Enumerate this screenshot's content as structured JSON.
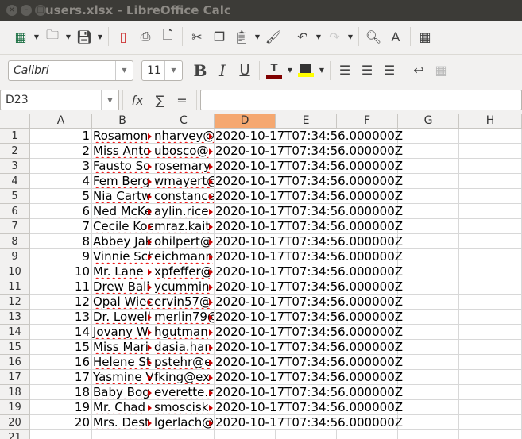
{
  "window": {
    "title": "users.xlsx - LibreOffice Calc"
  },
  "toolbar": {
    "font_name": "Calibri",
    "font_size": "11",
    "colors": {
      "font_color": "#800000",
      "highlight": "#ffff00"
    }
  },
  "formula_bar": {
    "name_box": "D23",
    "formula": ""
  },
  "columns": [
    "A",
    "B",
    "C",
    "D",
    "E",
    "F",
    "G",
    "H"
  ],
  "selected_column": "D",
  "rows": [
    {
      "id": "1",
      "name": "Rosamon",
      "email": "nharvey@",
      "date": "2020-10-17T07:34:56.000000Z"
    },
    {
      "id": "2",
      "name": "Miss Anto",
      "email": "ubosco@",
      "date": "2020-10-17T07:34:56.000000Z"
    },
    {
      "id": "3",
      "name": "Fausto So",
      "email": "rosemary",
      "date": "2020-10-17T07:34:56.000000Z"
    },
    {
      "id": "4",
      "name": "Fem Berg",
      "email": "wmayert@",
      "date": "2020-10-17T07:34:56.000000Z"
    },
    {
      "id": "5",
      "name": "Nia Cartw",
      "email": "constance",
      "date": "2020-10-17T07:34:56.000000Z"
    },
    {
      "id": "6",
      "name": "Ned McKe",
      "email": "aylin.rice",
      "date": "2020-10-17T07:34:56.000000Z"
    },
    {
      "id": "7",
      "name": "Cecile Koe",
      "email": "mraz.kait",
      "date": "2020-10-17T07:34:56.000000Z"
    },
    {
      "id": "8",
      "name": "Abbey Jak",
      "email": "ohilpert@",
      "date": "2020-10-17T07:34:56.000000Z"
    },
    {
      "id": "9",
      "name": "Vinnie Sch",
      "email": "eichmann",
      "date": "2020-10-17T07:34:56.000000Z"
    },
    {
      "id": "10",
      "name": "Mr. Lane",
      "email": "xpfeffer@",
      "date": "2020-10-17T07:34:56.000000Z"
    },
    {
      "id": "11",
      "name": "Drew Bali",
      "email": "ycummin",
      "date": "2020-10-17T07:34:56.000000Z"
    },
    {
      "id": "12",
      "name": "Opal Wiec",
      "email": "ervin57@",
      "date": "2020-10-17T07:34:56.000000Z"
    },
    {
      "id": "13",
      "name": "Dr. Lowell",
      "email": "merlin79@",
      "date": "2020-10-17T07:34:56.000000Z"
    },
    {
      "id": "14",
      "name": "Jovany W",
      "email": "hgutman",
      "date": "2020-10-17T07:34:56.000000Z"
    },
    {
      "id": "15",
      "name": "Miss Mari",
      "email": "dasia.han",
      "date": "2020-10-17T07:34:56.000000Z"
    },
    {
      "id": "16",
      "name": "Helene St",
      "email": "pstehr@e",
      "date": "2020-10-17T07:34:56.000000Z"
    },
    {
      "id": "17",
      "name": "Yasmine V",
      "email": "fking@ex",
      "date": "2020-10-17T07:34:56.000000Z"
    },
    {
      "id": "18",
      "name": "Baby Bog",
      "email": "everette.r",
      "date": "2020-10-17T07:34:56.000000Z"
    },
    {
      "id": "19",
      "name": "Mr. Chad",
      "email": "smoscisk",
      "date": "2020-10-17T07:34:56.000000Z"
    },
    {
      "id": "20",
      "name": "Mrs. Dest",
      "email": "lgerlach@",
      "date": "2020-10-17T07:34:56.000000Z"
    }
  ],
  "row_numbers": [
    "1",
    "2",
    "3",
    "4",
    "5",
    "6",
    "7",
    "8",
    "9",
    "10",
    "11",
    "12",
    "13",
    "14",
    "15",
    "16",
    "17",
    "18",
    "19",
    "20",
    "21"
  ]
}
